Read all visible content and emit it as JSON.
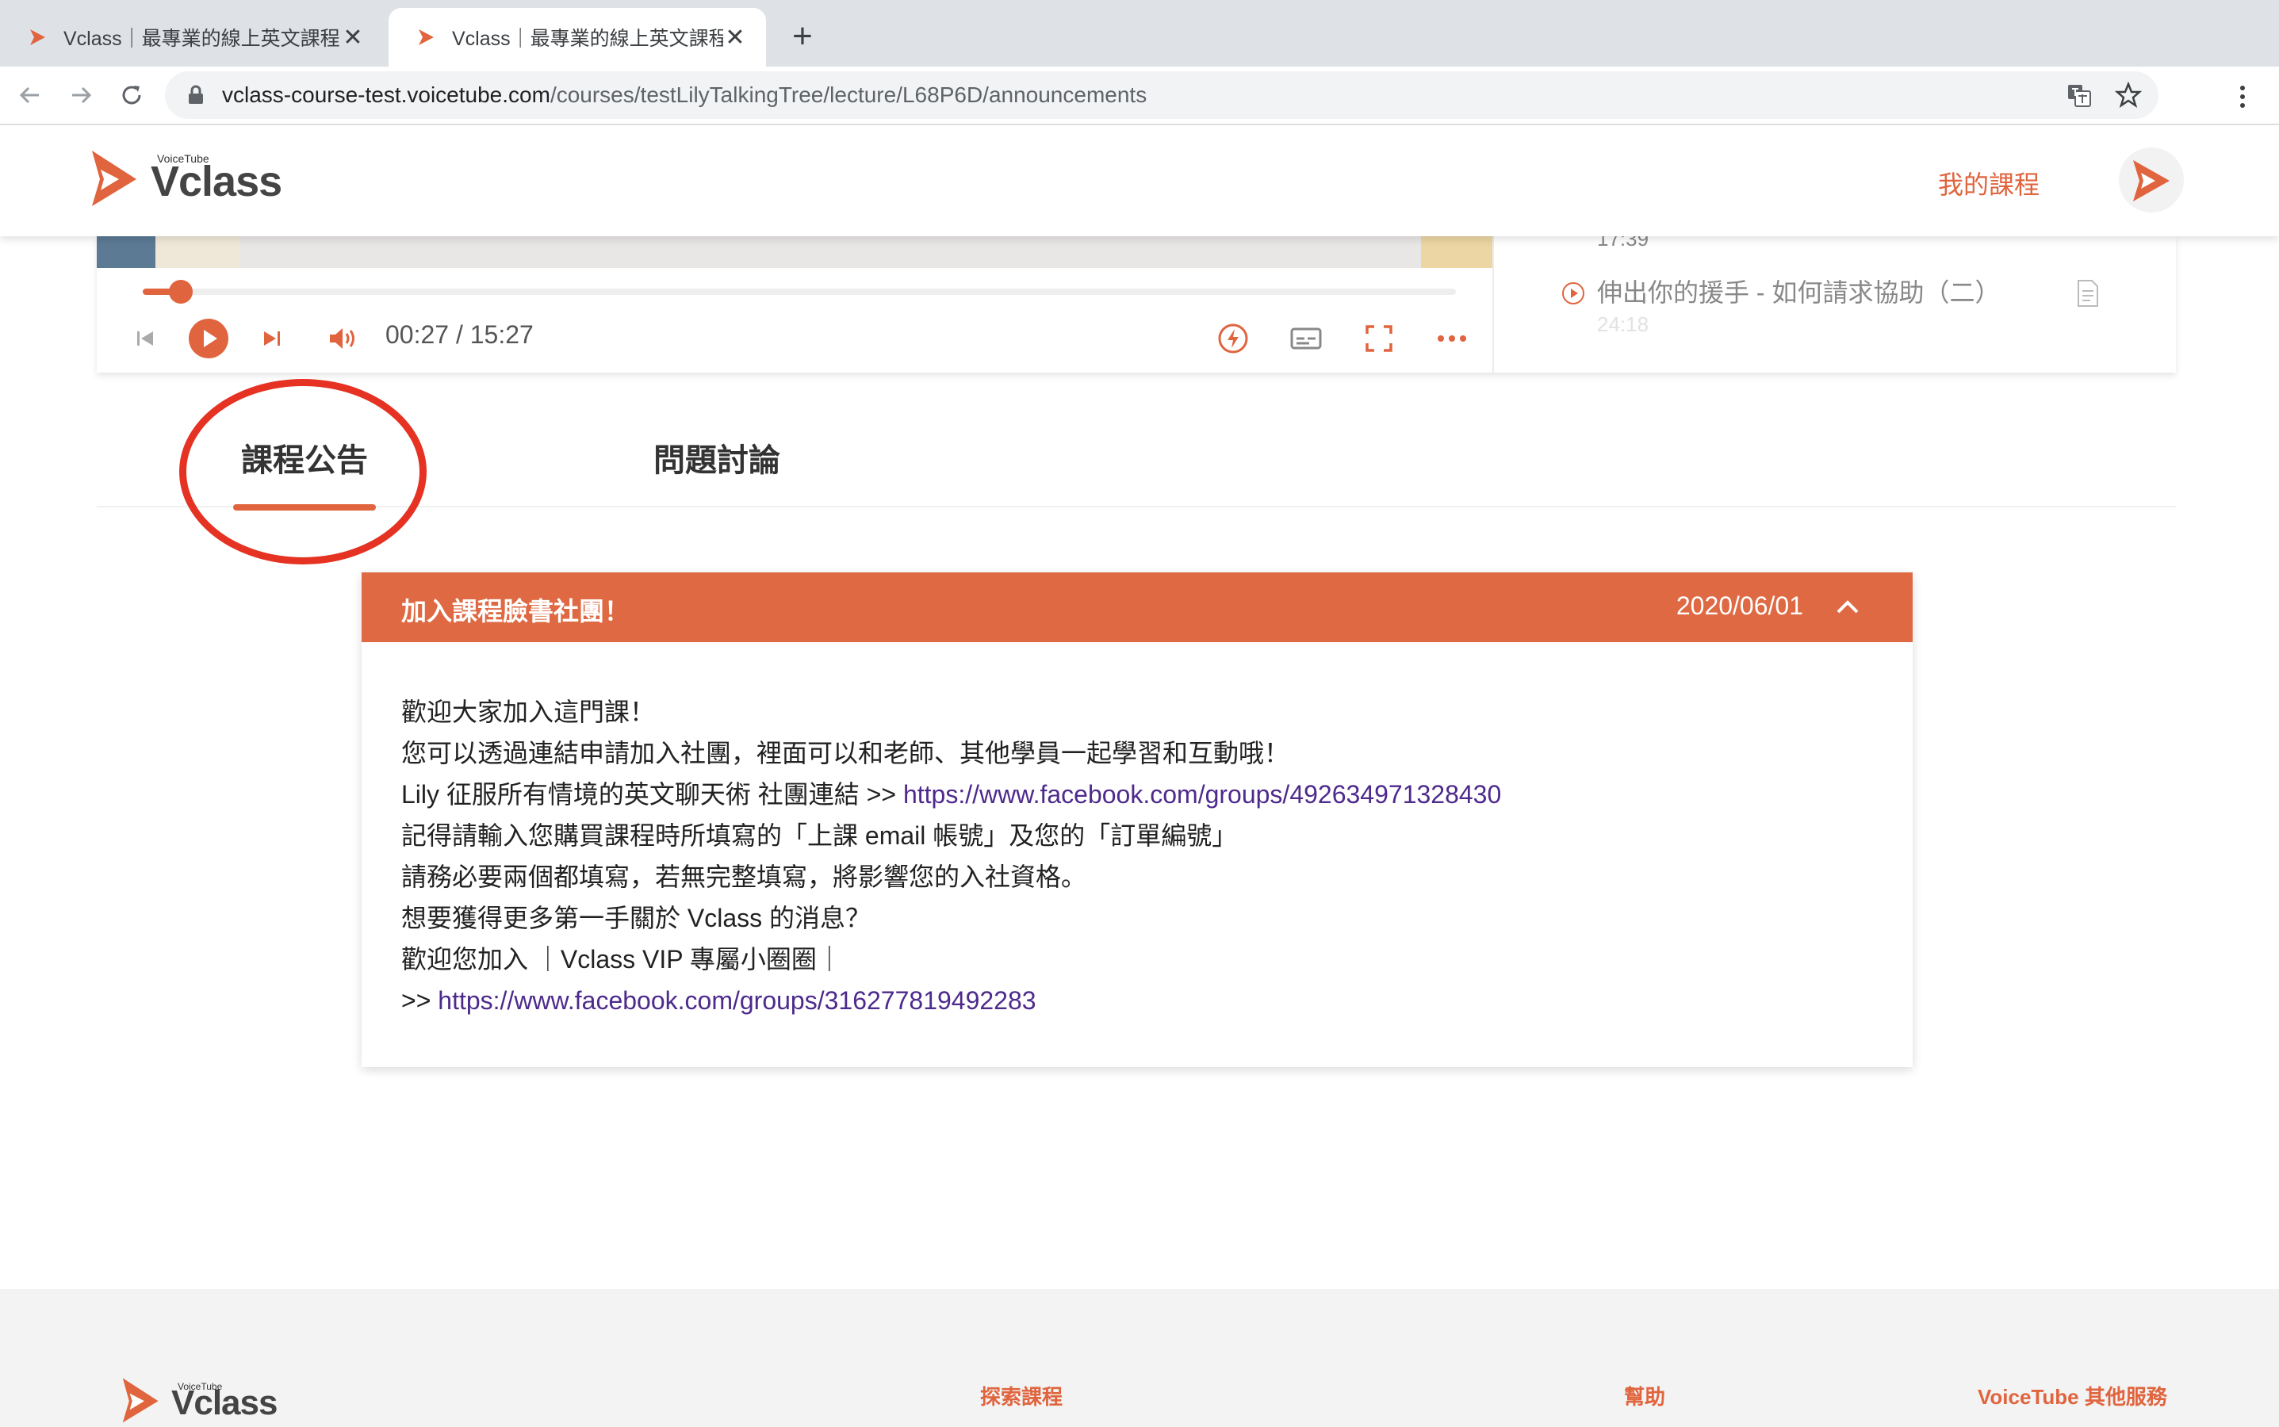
{
  "browser": {
    "tabs": [
      {
        "title": "Vclass｜最專業的線上英文課程",
        "active": false
      },
      {
        "title": "Vclass｜最專業的線上英文課程",
        "active": true
      }
    ],
    "new_tab_label": "+",
    "close_label": "✕",
    "url_host": "vclass-course-test.voicetube.com",
    "url_path": "/courses/testLilyTalkingTree/lecture/L68P6D/announcements"
  },
  "header": {
    "logo_small": "VoiceTube",
    "logo_big": "Vclass",
    "my_courses": "我的課程"
  },
  "player": {
    "progress": 0.029,
    "time": "00:27 / 15:27"
  },
  "lesson_list": {
    "prev_duration": "17:39",
    "current_title": "伸出你的援手 - 如何請求協助（二）",
    "current_duration": "24:18"
  },
  "page_tabs": {
    "announcements": "課程公告",
    "discussion": "問題討論"
  },
  "announcement": {
    "title": "加入課程臉書社團！",
    "date": "2020/06/01",
    "lines": {
      "l1": "歡迎大家加入這門課！",
      "l2": "您可以透過連結申請加入社團，裡面可以和老師、其他學員一起學習和互動哦！",
      "l3_prefix": "Lily 征服所有情境的英文聊天術 社團連結 >> ",
      "l3_link": "https://www.facebook.com/groups/492634971328430",
      "l4": "記得請輸入您購買課程時所填寫的「上課 email 帳號」及您的「訂單編號」",
      "l5": "請務必要兩個都填寫，若無完整填寫，將影響您的入社資格。",
      "l6": "想要獲得更多第一手關於 Vclass 的消息？",
      "l7": "歡迎您加入 ｜Vclass VIP 專屬小圈圈｜",
      "l8_prefix": ">> ",
      "l8_link": "https://www.facebook.com/groups/316277819492283"
    }
  },
  "footer": {
    "logo_small": "VoiceTube",
    "logo_big": "Vclass",
    "explore": "探索課程",
    "help": "幫助",
    "other_services": "VoiceTube 其他服務"
  },
  "colors": {
    "brand": "#e0643e",
    "announcement_header": "#de6942",
    "link": "#4d2a8c",
    "annotation": "#e53222"
  }
}
